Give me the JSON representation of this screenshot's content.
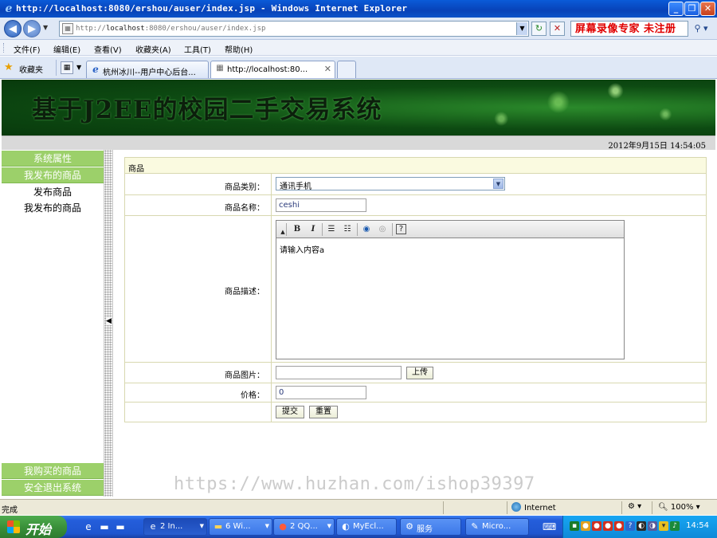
{
  "window": {
    "title": "http://localhost:8080/ershou/auser/index.jsp - Windows Internet Explorer",
    "controls": [
      "_",
      "❐",
      "✕"
    ]
  },
  "address": {
    "url_prefix": "http://",
    "url_host": "localhost",
    "url_path": ":8080/ershou/auser/index.jsp"
  },
  "recorder_watermark": "屏幕录像专家 未注册",
  "menu": {
    "items": [
      "文件(F)",
      "编辑(E)",
      "查看(V)",
      "收藏夹(A)",
      "工具(T)",
      "帮助(H)"
    ]
  },
  "favorites": {
    "label": "收藏夹",
    "tabs": [
      {
        "label": "杭州冰川--用户中心后台...",
        "active": false
      },
      {
        "label": "http://localhost:80...",
        "active": true
      }
    ]
  },
  "page": {
    "banner_title": "基于J2EE的校园二手交易系统",
    "datetime": "2012年9月15日  14:54:05",
    "sidebar": {
      "sections": [
        {
          "label": "系统属性"
        },
        {
          "label": "我发布的商品"
        }
      ],
      "links": [
        "发布商品",
        "我发布的商品"
      ],
      "bottom_sections": [
        "我购买的商品",
        "安全退出系统"
      ]
    },
    "form": {
      "header": "商品",
      "category_label": "商品类别：",
      "category_value": "通讯手机",
      "name_label": "商品名称：",
      "name_value": "ceshi",
      "description_label": "商品描述：",
      "description_text": "请输入内容a",
      "image_label": "商品图片：",
      "upload_button": "上传",
      "price_label": "价格：",
      "price_value": "0",
      "submit_button": "提交",
      "reset_button": "重置"
    }
  },
  "site_watermark": "https://www.huzhan.com/ishop39397",
  "status": {
    "text": "完成",
    "zone": "Internet",
    "zoom": "100%"
  },
  "taskbar": {
    "start": "开始",
    "tasks": [
      {
        "label": "2 In...",
        "icon": "ie-icon"
      },
      {
        "label": "6 Wi...",
        "icon": "folder-icon"
      },
      {
        "label": "2 QQ...",
        "icon": "qq-icon"
      },
      {
        "label": "MyEcl...",
        "icon": "eclipse-icon"
      },
      {
        "label": "服务",
        "icon": "services-icon"
      },
      {
        "label": "Micro...",
        "icon": "tool-icon"
      }
    ],
    "clock": "14:54"
  }
}
